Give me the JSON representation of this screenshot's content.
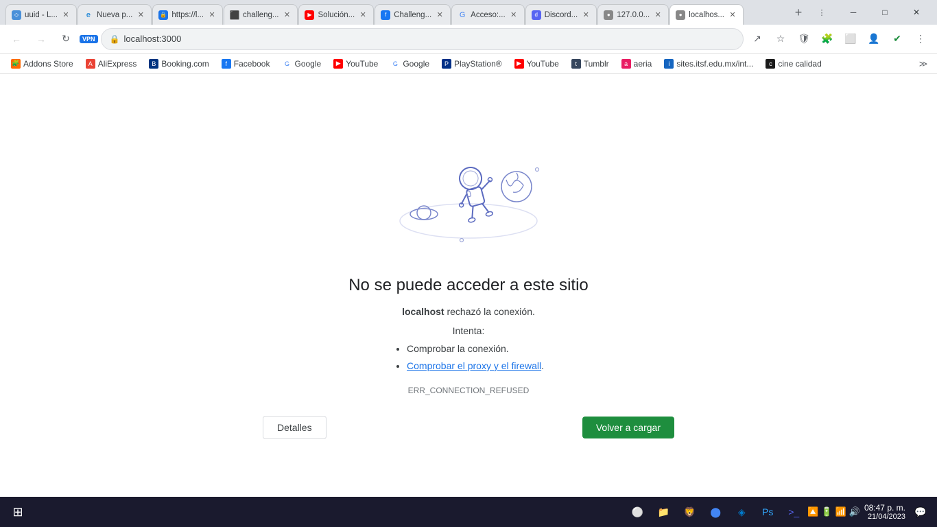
{
  "browser": {
    "tabs": [
      {
        "id": "uuid",
        "label": "uuid - L...",
        "favicon_type": "uuid",
        "favicon_text": "◇",
        "active": false,
        "closable": true
      },
      {
        "id": "nueva",
        "label": "Nueva p...",
        "favicon_type": "edge",
        "favicon_text": "e",
        "active": false,
        "closable": true
      },
      {
        "id": "https",
        "label": "https://l...",
        "favicon_type": "https",
        "favicon_text": "🔒",
        "active": false,
        "closable": true
      },
      {
        "id": "github",
        "label": "challeng...",
        "favicon_type": "github",
        "favicon_text": "⬛",
        "active": false,
        "closable": true
      },
      {
        "id": "solution",
        "label": "Solución...",
        "favicon_type": "solution",
        "favicon_text": "▶",
        "active": false,
        "closable": true
      },
      {
        "id": "challenge",
        "label": "Challeng...",
        "favicon_type": "challenge",
        "favicon_text": "f",
        "active": false,
        "closable": true
      },
      {
        "id": "gacceso",
        "label": "Acceso:...",
        "favicon_type": "gacceso",
        "favicon_text": "G",
        "active": false,
        "closable": true
      },
      {
        "id": "discord",
        "label": "Discord...",
        "favicon_type": "discord2",
        "favicon_text": "d",
        "active": false,
        "closable": true
      },
      {
        "id": "local2",
        "label": "127.0.0...",
        "favicon_type": "local",
        "favicon_text": "●",
        "active": false,
        "closable": true
      },
      {
        "id": "localhost",
        "label": "localhos...",
        "favicon_type": "local",
        "favicon_text": "●",
        "active": true,
        "closable": true
      }
    ],
    "address": "localhost:3000",
    "nav": {
      "back_disabled": true,
      "forward_disabled": true,
      "vpn_label": "VPN"
    }
  },
  "bookmarks": [
    {
      "label": "Addons Store",
      "favicon_type": "fav-orange",
      "favicon_text": "🧩"
    },
    {
      "label": "AliExpress",
      "favicon_type": "fav-red",
      "favicon_text": "A"
    },
    {
      "label": "Booking.com",
      "favicon_type": "fav-blue-b-bk",
      "favicon_text": "B"
    },
    {
      "label": "Facebook",
      "favicon_type": "fav-blue-b",
      "favicon_text": "f"
    },
    {
      "label": "Google",
      "favicon_type": "fav-google-g",
      "favicon_text": "G"
    },
    {
      "label": "YouTube",
      "favicon_type": "fav-yt",
      "favicon_text": "▶"
    },
    {
      "label": "Google",
      "favicon_type": "fav-google-g",
      "favicon_text": "G"
    },
    {
      "label": "PlayStation®",
      "favicon_type": "fav-ps",
      "favicon_text": "P"
    },
    {
      "label": "YouTube",
      "favicon_type": "fav-yt",
      "favicon_text": "▶"
    },
    {
      "label": "Tumblr",
      "favicon_type": "fav-tumblr",
      "favicon_text": "t"
    },
    {
      "label": "aeria",
      "favicon_type": "fav-aeria",
      "favicon_text": "a"
    },
    {
      "label": "sites.itsf.edu.mx/int...",
      "favicon_type": "fav-itsf",
      "favicon_text": "i"
    },
    {
      "label": "cine calidad",
      "favicon_type": "fav-cine",
      "favicon_text": "c"
    }
  ],
  "error_page": {
    "title": "No se puede acceder a este sitio",
    "host": "localhost",
    "connection_msg": " rechazó la conexión.",
    "try_label": "Intenta:",
    "suggestions": [
      {
        "text": "Comprobar la conexión.",
        "link": false
      },
      {
        "text": "Comprobar el proxy y el firewall",
        "link": true
      }
    ],
    "dot_after_link": ".",
    "error_code": "ERR_CONNECTION_REFUSED",
    "btn_details": "Detalles",
    "btn_reload": "Volver a cargar"
  },
  "taskbar": {
    "apps": [
      {
        "name": "windows-start",
        "icon": "⊞",
        "color": "#00adef"
      },
      {
        "name": "edge-icon",
        "icon": "e",
        "color": "#0078d4"
      },
      {
        "name": "file-explorer",
        "icon": "📁",
        "color": "#ffb900"
      },
      {
        "name": "brave-browser",
        "icon": "B",
        "color": "#fb542b"
      },
      {
        "name": "chrome-icon",
        "icon": "◉",
        "color": "#4285f4"
      },
      {
        "name": "vscode-icon",
        "icon": "⬡",
        "color": "#007acc"
      },
      {
        "name": "photoshop-icon",
        "icon": "Ps",
        "color": "#31a8ff"
      },
      {
        "name": "powershell-icon",
        "icon": ">_",
        "color": "#5865f2"
      }
    ],
    "sys_icons": [
      "🔼",
      "🔋",
      "📶",
      "🔊"
    ],
    "time": "08:47 p. m.",
    "date": "21/04/2023"
  }
}
